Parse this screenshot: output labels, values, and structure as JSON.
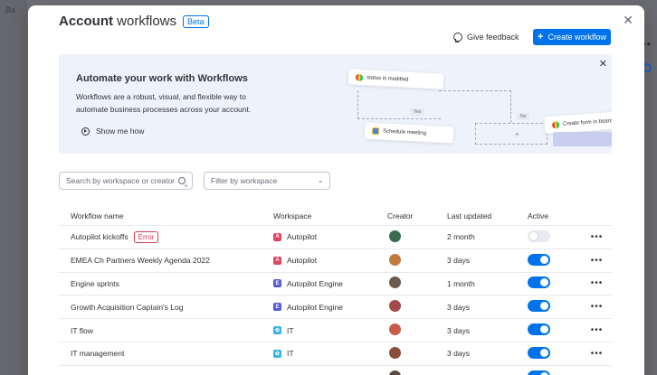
{
  "background": {
    "tab_label": "Ba"
  },
  "modal": {
    "title_bold": "Account",
    "title_rest": " workflows",
    "badge": "Beta",
    "give_feedback": "Give feedback",
    "create_button": "Create workflow",
    "banner": {
      "title": "Automate your work with Workflows",
      "description": "Workflows are a robust, visual, and flexible way to automate business processes across your account.",
      "show_me": "Show me how",
      "cards": {
        "status": "status is modified",
        "meeting": "Schedule meeting",
        "form": "Create form in board"
      },
      "pills": {
        "yes": "Yes",
        "no": "No"
      }
    },
    "search": {
      "placeholder": "Search by workspace or creator"
    },
    "filter": {
      "placeholder": "Filter by workspace"
    },
    "table": {
      "headers": {
        "name": "Workflow name",
        "workspace": "Workspace",
        "creator": "Creator",
        "updated": "Last updated",
        "active": "Active"
      },
      "rows": [
        {
          "name": "Autopilot kickoffs",
          "error": "Error",
          "workspace": "Autopilot",
          "ws_letter": "A",
          "ws_color": "#e2445c",
          "avatar": "#3a6b4f",
          "updated": "2 month",
          "active": false
        },
        {
          "name": "EMEA Ch Partners Weekly Agenda 2022",
          "error": "",
          "workspace": "Autopilot",
          "ws_letter": "A",
          "ws_color": "#e2445c",
          "avatar": "#c27a3e",
          "updated": "3 days",
          "active": true
        },
        {
          "name": "Engine sprints",
          "error": "",
          "workspace": "Autopilot Engine",
          "ws_letter": "E",
          "ws_color": "#5559df",
          "avatar": "#6b5a4c",
          "updated": "1 month",
          "active": true
        },
        {
          "name": "Growth Acquisition Captain's Log",
          "error": "",
          "workspace": "Autopilot Engine",
          "ws_letter": "E",
          "ws_color": "#5559df",
          "avatar": "#a34a4a",
          "updated": "3 days",
          "active": true
        },
        {
          "name": "IT flow",
          "error": "",
          "workspace": "IT",
          "ws_letter": "✿",
          "ws_color": "#33b5e5",
          "avatar": "#c95b4a",
          "updated": "3 days",
          "active": true
        },
        {
          "name": "IT management",
          "error": "",
          "workspace": "IT",
          "ws_letter": "✿",
          "ws_color": "#33b5e5",
          "avatar": "#8a4d3c",
          "updated": "3 days",
          "active": true
        },
        {
          "name": "",
          "error": "",
          "workspace": "",
          "ws_letter": "",
          "ws_color": "#33b5e5",
          "avatar": "#5a4a3c",
          "updated": "",
          "active": true
        }
      ]
    }
  }
}
